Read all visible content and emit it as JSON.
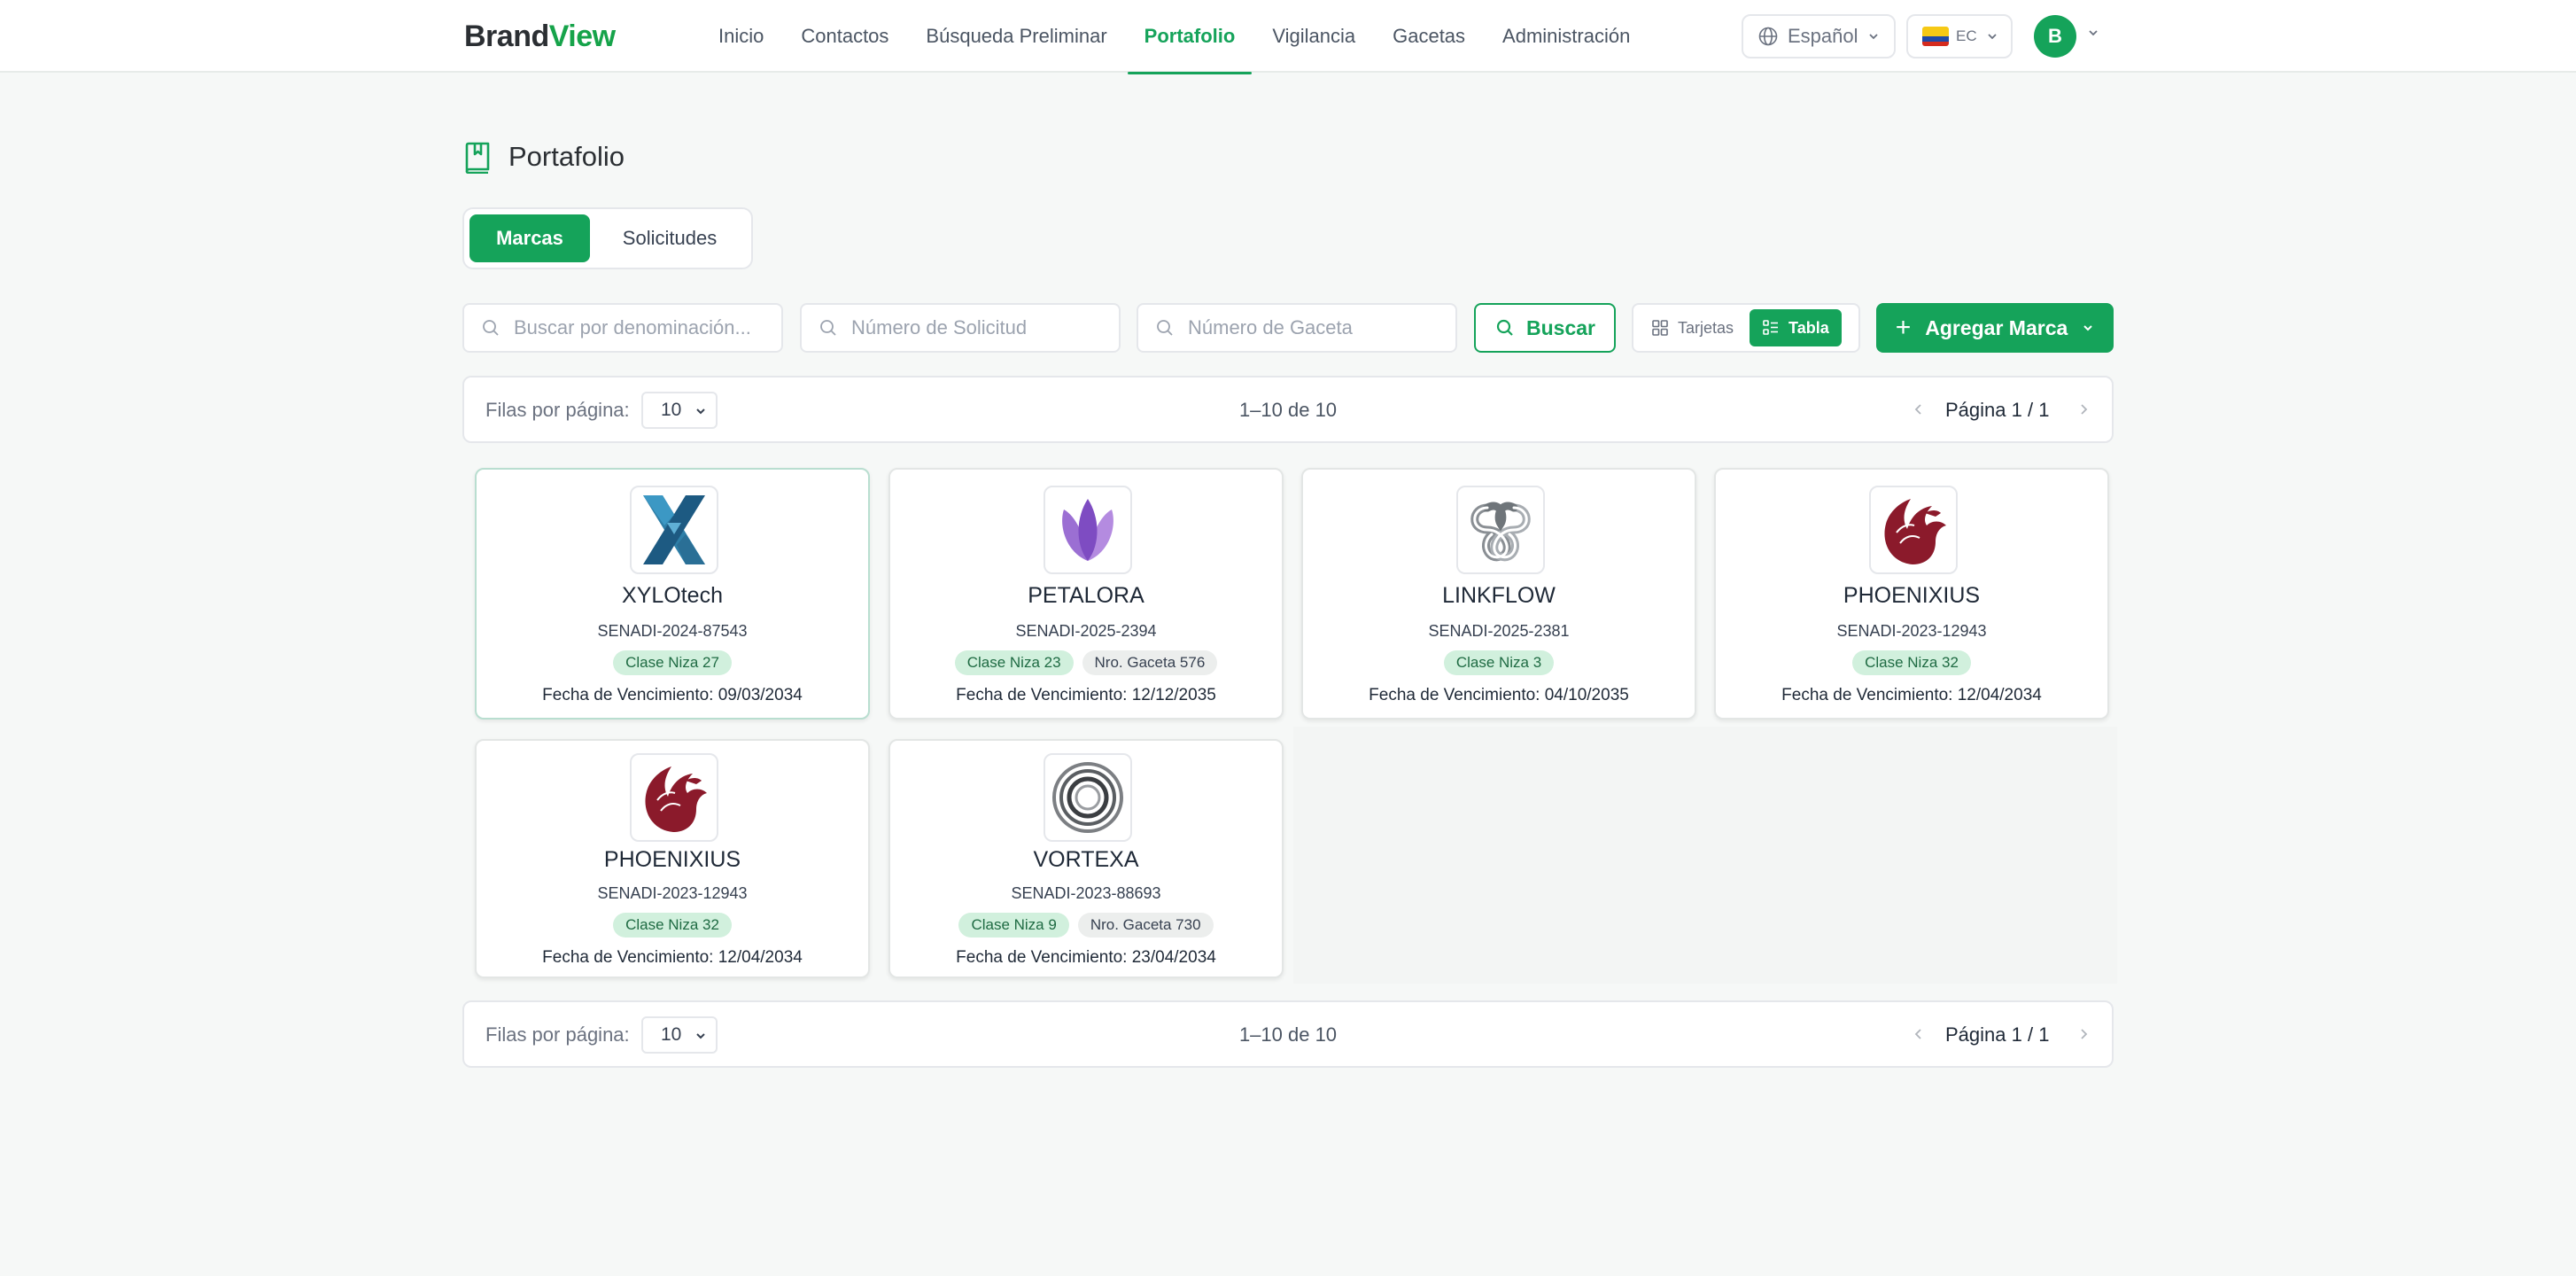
{
  "header": {
    "logo_brand": "Brand",
    "logo_view": "View",
    "nav": [
      "Inicio",
      "Contactos",
      "Búsqueda Preliminar",
      "Portafolio",
      "Vigilancia",
      "Gacetas",
      "Administración"
    ],
    "active_nav": "Portafolio",
    "language": "Español",
    "country": "EC",
    "avatar_initial": "B"
  },
  "page": {
    "title": "Portafolio"
  },
  "tabs": {
    "marcas": "Marcas",
    "solicitudes": "Solicitudes"
  },
  "filters": {
    "denominacion_placeholder": "Buscar por denominación...",
    "solicitud_placeholder": "Número de Solicitud",
    "gaceta_placeholder": "Número de Gaceta",
    "buscar_label": "Buscar",
    "view_cards_label": "Tarjetas",
    "view_table_label": "Tabla",
    "add_label": "Agregar Marca"
  },
  "pagination": {
    "rows_label": "Filas por página:",
    "rows_value": "10",
    "range": "1–10 de 10",
    "page_label": "Página 1 / 1"
  },
  "cards": [
    {
      "logo": "xylotech-x-logo",
      "name": "XYLOtech",
      "code": "SENADI-2024-87543",
      "clase": "Clase Niza 27",
      "gaceta": "",
      "expiry": "Fecha de Vencimiento: 09/03/2034"
    },
    {
      "logo": "petalora-lotus-logo",
      "name": "PETALORA",
      "code": "SENADI-2025-2394",
      "clase": "Clase Niza 23",
      "gaceta": "Nro. Gaceta 576",
      "expiry": "Fecha de Vencimiento: 12/12/2035"
    },
    {
      "logo": "linkflow-knot-logo",
      "name": "LINKFLOW",
      "code": "SENADI-2025-2381",
      "clase": "Clase Niza 3",
      "gaceta": "",
      "expiry": "Fecha de Vencimiento: 04/10/2035"
    },
    {
      "logo": "phoenixius-bird-logo",
      "name": "PHOENIXIUS",
      "code": "SENADI-2023-12943",
      "clase": "Clase Niza 32",
      "gaceta": "",
      "expiry": "Fecha de Vencimiento: 12/04/2034"
    },
    {
      "logo": "phoenixius-bird-logo",
      "name": "PHOENIXIUS",
      "code": "SENADI-2023-12943",
      "clase": "Clase Niza 32",
      "gaceta": "",
      "expiry": "Fecha de Vencimiento: 12/04/2034"
    },
    {
      "logo": "vortexa-rings-logo",
      "name": "VORTEXA",
      "code": "SENADI-2023-88693",
      "clase": "Clase Niza 9",
      "gaceta": "Nro. Gaceta 730",
      "expiry": "Fecha de Vencimiento: 23/04/2034"
    }
  ],
  "colors": {
    "accent": "#15a35a",
    "tag_green_bg": "#d1f0dd",
    "tag_gray_bg": "#eceeed",
    "phoenix": "#8b1a2b"
  }
}
